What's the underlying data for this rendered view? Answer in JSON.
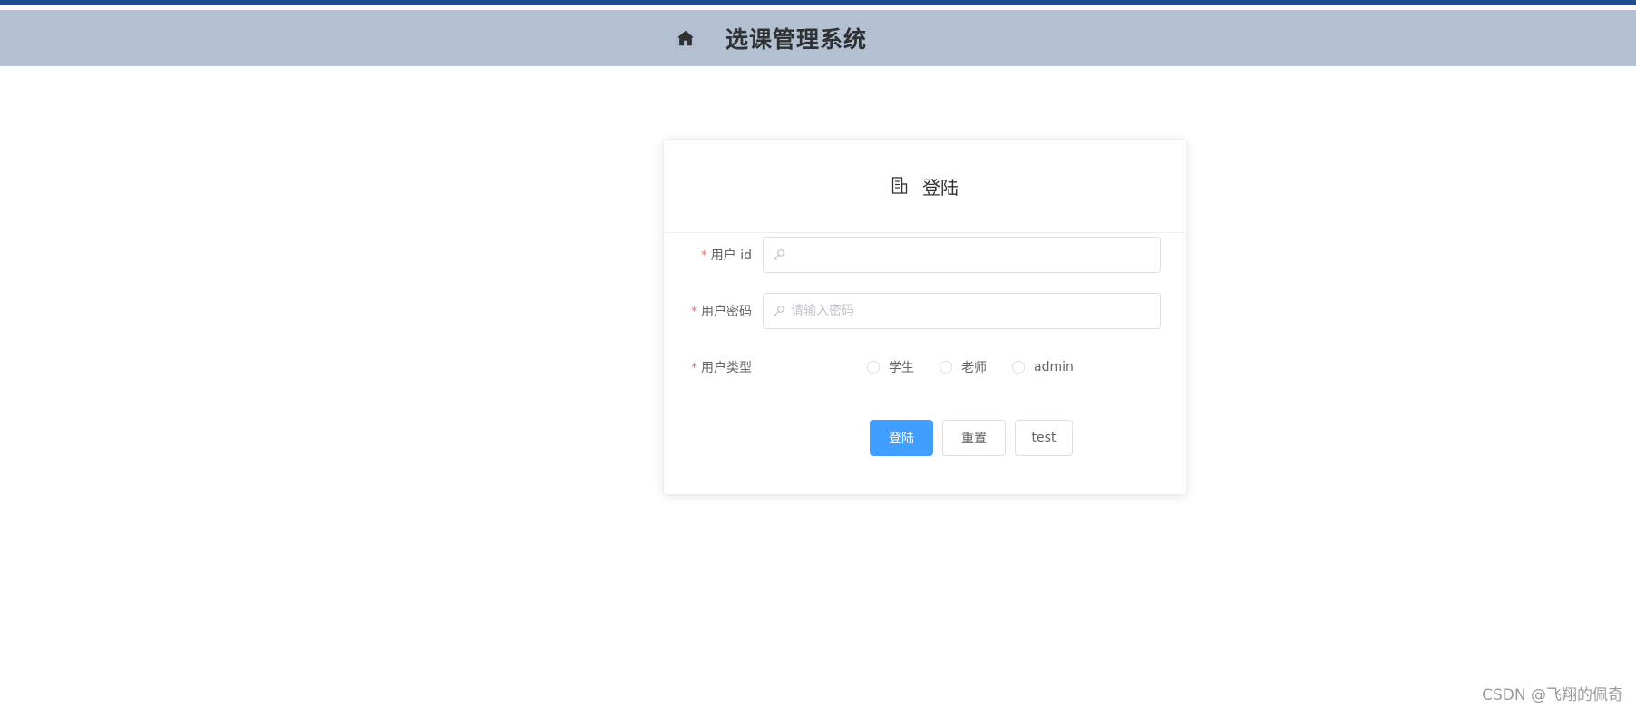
{
  "header": {
    "title": "选课管理系统",
    "icon": "home-icon"
  },
  "login_card": {
    "title": "登陆",
    "icon": "document-icon",
    "fields": {
      "user_id": {
        "label": "用户 id",
        "required_mark": "*",
        "value": "",
        "placeholder": "",
        "icon": "key-icon"
      },
      "password": {
        "label": "用户密码",
        "required_mark": "*",
        "value": "",
        "placeholder": "请输入密码",
        "icon": "key-icon"
      },
      "user_type": {
        "label": "用户类型",
        "required_mark": "*",
        "options": [
          "学生",
          "老师",
          "admin"
        ]
      }
    },
    "buttons": {
      "login": "登陆",
      "reset": "重置",
      "test": "test"
    }
  },
  "watermark": "CSDN @飞翔的佩奇",
  "colors": {
    "top_strip": "#1f4f8f",
    "header_bg": "#b3c0d1",
    "primary": "#409eff",
    "required": "#f56c6c"
  }
}
